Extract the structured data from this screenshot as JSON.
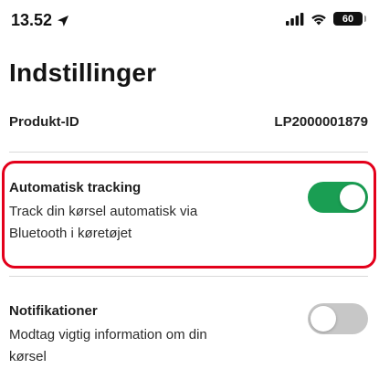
{
  "status_bar": {
    "time": "13.52",
    "battery": "60"
  },
  "page": {
    "title": "Indstillinger"
  },
  "product": {
    "label": "Produkt-ID",
    "value": "LP2000001879"
  },
  "settings": [
    {
      "title": "Automatisk tracking",
      "description": "Track din kørsel automatisk via Bluetooth i køretøjet",
      "enabled": true,
      "color": "#1a9e53"
    },
    {
      "title": "Notifikationer",
      "description": "Modtag vigtig information om din kørsel",
      "enabled": false,
      "color": "#c7c7c7"
    }
  ],
  "colors": {
    "highlight": "#e3001b",
    "toggle_on": "#1a9e53",
    "toggle_off": "#c7c7c7"
  }
}
